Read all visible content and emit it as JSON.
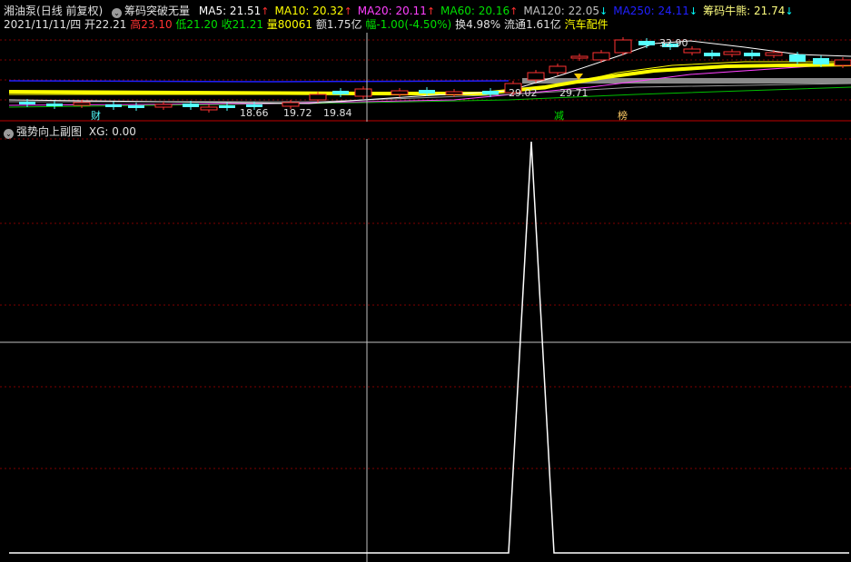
{
  "header": {
    "stock_name": "湘油泵",
    "period": "(日线 前复权)",
    "indicator_name": "筹码突破无量",
    "ma": [
      {
        "label": "MA5: 21.51",
        "arrow": "↑",
        "color": "#ffffff",
        "arrow_color": "#ff3030"
      },
      {
        "label": "MA10: 20.32",
        "arrow": "↑",
        "color": "#ffff00",
        "arrow_color": "#ff3030"
      },
      {
        "label": "MA20: 20.11",
        "arrow": "↑",
        "color": "#ff40ff",
        "arrow_color": "#ff3030"
      },
      {
        "label": "MA60: 20.16",
        "arrow": "↑",
        "color": "#00e000",
        "arrow_color": "#ff3030"
      },
      {
        "label": "MA120: 22.05",
        "arrow": "↓",
        "color": "#c0c0c0",
        "arrow_color": "#00ffff"
      },
      {
        "label": "MA250: 24.11",
        "arrow": "↓",
        "color": "#2020ff",
        "arrow_color": "#00ffff"
      },
      {
        "label": "筹码牛熊: 21.74",
        "arrow": "↓",
        "color": "#ffff80",
        "arrow_color": "#00ffff"
      }
    ]
  },
  "quote": {
    "date": "2021/11/11/四",
    "open": "开22.21",
    "high": "高23.10",
    "low": "低21.20",
    "close": "收21.21",
    "volume": "量80061",
    "amount": "额1.75亿",
    "change": "幅-1.00(-4.50%)",
    "turnover": "换4.98%",
    "float": "流通1.61亿",
    "sector": "汽车配件"
  },
  "main_chart": {
    "price_labels": [
      "32.90",
      "18.66",
      "19.72",
      "19.84",
      "29.02",
      "29.71"
    ],
    "event_tags": [
      "财",
      "减",
      "榜"
    ]
  },
  "sub_chart": {
    "title": "强势向上副图",
    "value_label": "XG: 0.00",
    "xg_values": [
      0,
      0,
      0,
      0,
      0,
      0,
      0,
      0,
      0,
      0,
      0,
      0,
      0,
      0,
      0,
      0,
      0,
      0,
      0,
      0,
      0,
      0,
      0,
      1,
      0,
      0,
      0,
      0,
      0,
      0,
      0,
      0,
      0,
      0,
      0,
      0,
      0,
      0
    ],
    "ylim": [
      0,
      1
    ]
  },
  "colors": {
    "grid": "#800000",
    "up": "#ff3232",
    "down": "#54ffff",
    "crosshair": "#c0c0c0"
  }
}
